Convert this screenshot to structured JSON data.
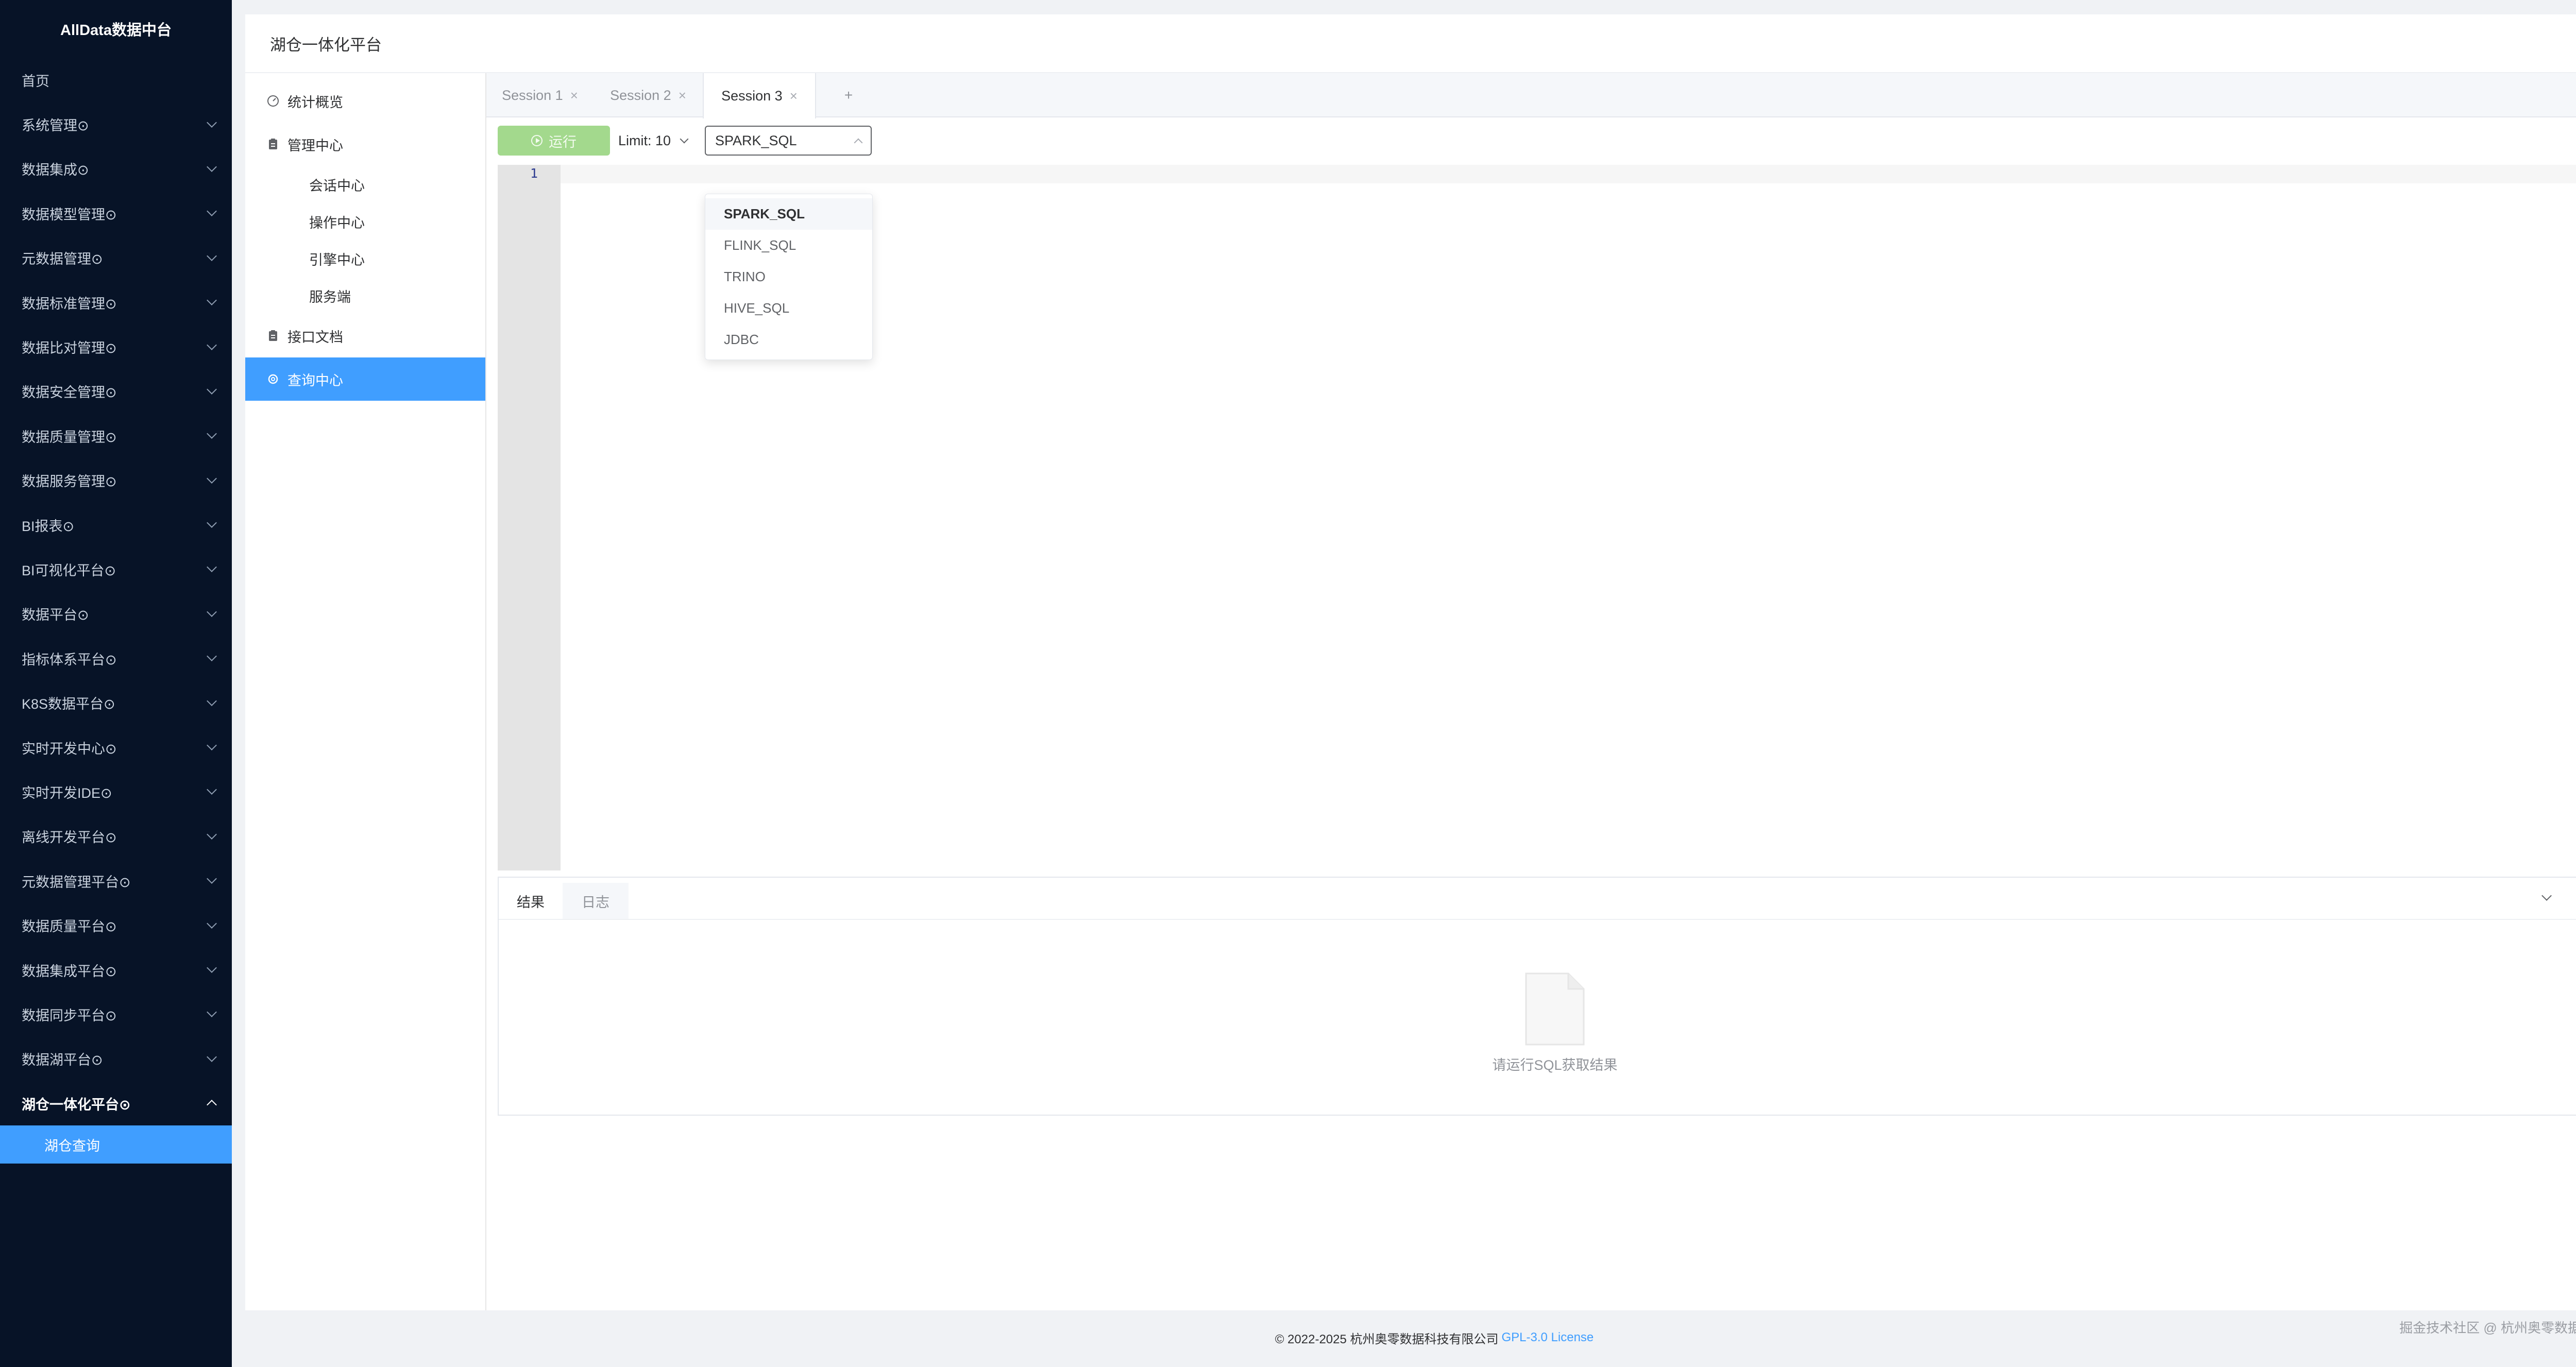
{
  "app": {
    "brand": "AllData数据中台"
  },
  "sidebar": {
    "items": [
      {
        "label": "首页",
        "has_children": false
      },
      {
        "label": "系统管理⊙",
        "has_children": true
      },
      {
        "label": "数据集成⊙",
        "has_children": true
      },
      {
        "label": "数据模型管理⊙",
        "has_children": true
      },
      {
        "label": "元数据管理⊙",
        "has_children": true
      },
      {
        "label": "数据标准管理⊙",
        "has_children": true
      },
      {
        "label": "数据比对管理⊙",
        "has_children": true
      },
      {
        "label": "数据安全管理⊙",
        "has_children": true
      },
      {
        "label": "数据质量管理⊙",
        "has_children": true
      },
      {
        "label": "数据服务管理⊙",
        "has_children": true
      },
      {
        "label": "BI报表⊙",
        "has_children": true
      },
      {
        "label": "BI可视化平台⊙",
        "has_children": true
      },
      {
        "label": "数据平台⊙",
        "has_children": true
      },
      {
        "label": "指标体系平台⊙",
        "has_children": true
      },
      {
        "label": "K8S数据平台⊙",
        "has_children": true
      },
      {
        "label": "实时开发中心⊙",
        "has_children": true
      },
      {
        "label": "实时开发IDE⊙",
        "has_children": true
      },
      {
        "label": "离线开发平台⊙",
        "has_children": true
      },
      {
        "label": "元数据管理平台⊙",
        "has_children": true
      },
      {
        "label": "数据质量平台⊙",
        "has_children": true
      },
      {
        "label": "数据集成平台⊙",
        "has_children": true
      },
      {
        "label": "数据同步平台⊙",
        "has_children": true
      },
      {
        "label": "数据湖平台⊙",
        "has_children": true
      },
      {
        "label": "湖仓一体化平台⊙",
        "has_children": true,
        "open": true
      }
    ],
    "active_sub": "湖仓查询"
  },
  "header": {
    "title": "湖仓一体化平台"
  },
  "submenu": {
    "overview": "统计概览",
    "manage": "管理中心",
    "children": [
      "会话中心",
      "操作中心",
      "引擎中心",
      "服务端"
    ],
    "api_docs": "接口文档",
    "query": "查询中心"
  },
  "tabs": [
    {
      "label": "Session 1",
      "close": "×"
    },
    {
      "label": "Session 2",
      "close": "×"
    },
    {
      "label": "Session 3",
      "close": "×",
      "active": true
    }
  ],
  "add_tab": "+",
  "toolbar": {
    "run_label": "运行",
    "limit_label": "Limit: 10",
    "engine_value": "SPARK_SQL"
  },
  "editor": {
    "line_number": "1"
  },
  "engine_options": [
    "SPARK_SQL",
    "FLINK_SQL",
    "TRINO",
    "HIVE_SQL",
    "JDBC"
  ],
  "results": {
    "tab_results": "结果",
    "tab_logs": "日志",
    "empty_text": "请运行SQL获取结果"
  },
  "footer": {
    "copyright": "© 2022-2025 杭州奥零数据科技有限公司",
    "license": "GPL-3.0 License"
  },
  "watermark": "掘金技术社区 @ 杭州奥零数据科技",
  "colors": {
    "sidebar_bg": "#071327",
    "accent": "#409eff",
    "run_button": "#a3d98d"
  }
}
